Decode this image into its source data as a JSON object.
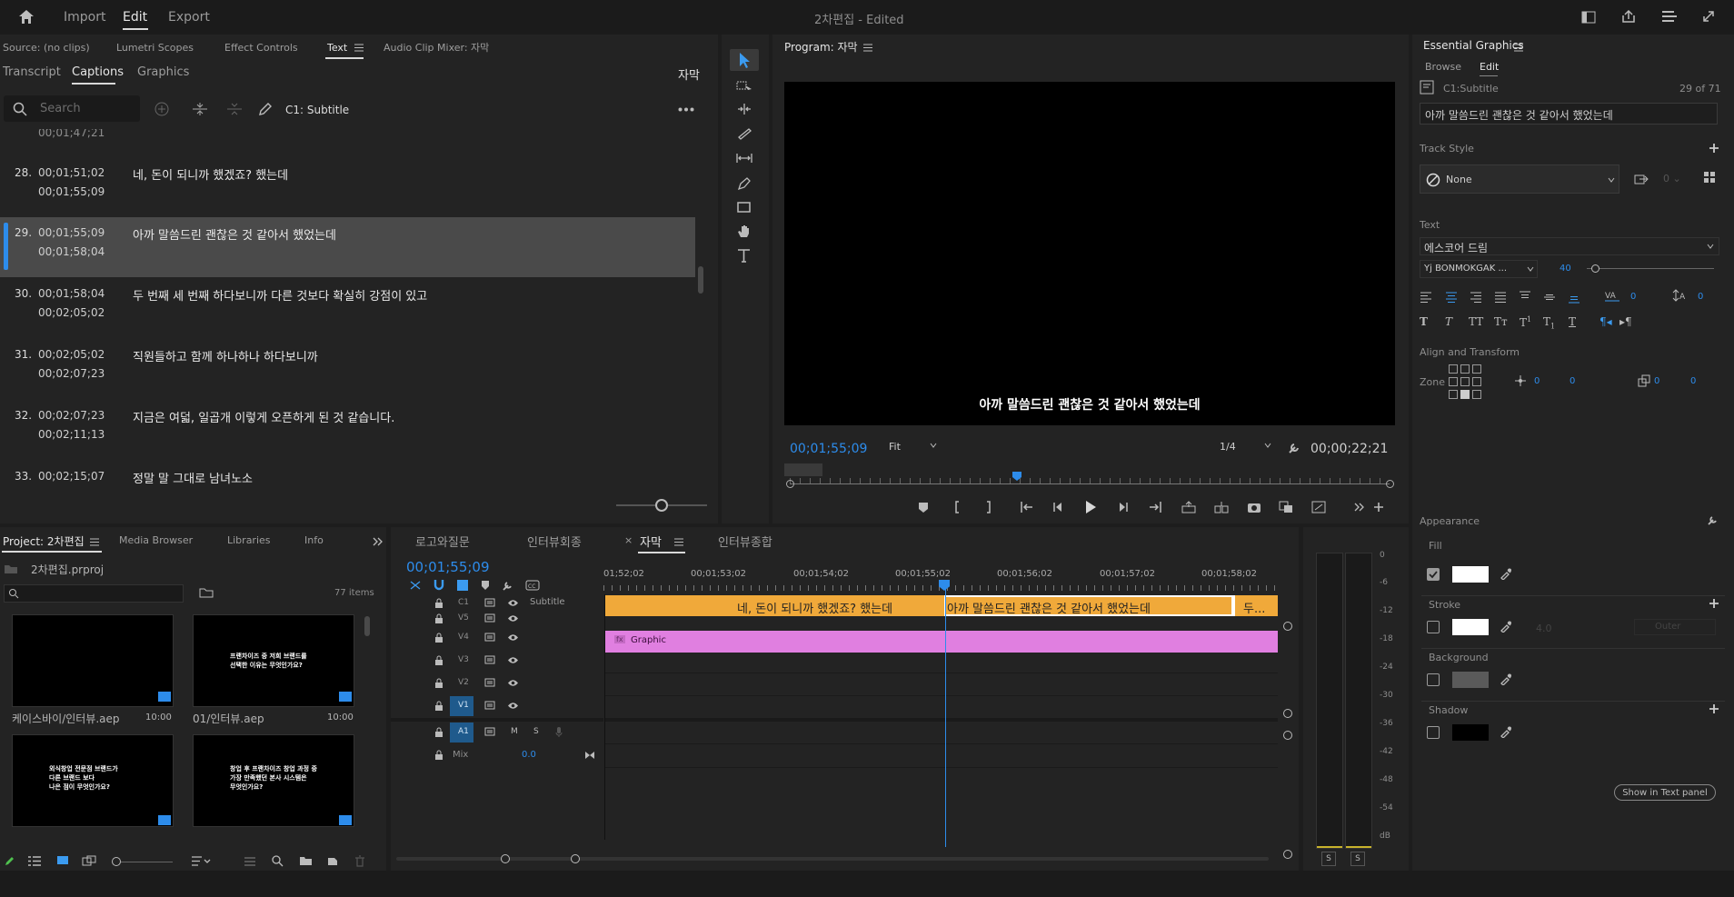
{
  "app": {
    "title": "2차편집",
    "title_suffix": "- Edited",
    "nav": [
      "Import",
      "Edit",
      "Export"
    ],
    "active_nav": "Edit"
  },
  "source_tabs": [
    "Source: (no clips)",
    "Lumetri Scopes",
    "Effect Controls",
    "Text",
    "Audio Clip Mixer: 자막"
  ],
  "text_panel": {
    "subtabs": [
      "Transcript",
      "Captions",
      "Graphics"
    ],
    "right_label": "자막",
    "search_placeholder": "Search",
    "track_label": "C1: Subtitle",
    "captions": [
      {
        "num": "",
        "start": "00;01;47;21",
        "end": "",
        "text": ""
      },
      {
        "num": "28.",
        "start": "00;01;51;02",
        "end": "00;01;55;09",
        "text": "네, 돈이 되니까 했겠죠? 했는데"
      },
      {
        "num": "29.",
        "start": "00;01;55;09",
        "end": "00;01;58;04",
        "text": "아까 말씀드린 괜찮은 것 같아서 했었는데"
      },
      {
        "num": "30.",
        "start": "00;01;58;04",
        "end": "00;02;05;02",
        "text": "두 번째  세 번째 하다보니까 다른 것보다 확실히 강점이 있고"
      },
      {
        "num": "31.",
        "start": "00;02;05;02",
        "end": "00;02;07;23",
        "text": "직원들하고 함께 하나하나 하다보니까"
      },
      {
        "num": "32.",
        "start": "00;02;07;23",
        "end": "00;02;11;13",
        "text": "지금은 여덟, 일곱개 이렇게 오픈하게 된 것 같습니다."
      },
      {
        "num": "33.",
        "start": "00;02;15;07",
        "end": "",
        "text": "정말 말 그대로 남녀노소"
      }
    ]
  },
  "program": {
    "title": "Program: 자막",
    "subtitle": "아까 말씀드린 괜찮은 것 같아서 했었는데",
    "timecode": "00;01;55;09",
    "fit": "Fit",
    "quality": "1/4",
    "duration": "00;00;22;21"
  },
  "project": {
    "tabs": [
      "Project: 2차편집",
      "Media Browser",
      "Libraries",
      "Info"
    ],
    "file": "2차편집.prproj",
    "items": "77 items",
    "thumbs": [
      {
        "name": "케이스바이/인터뷰.aep",
        "dur": "10:00",
        "lines": []
      },
      {
        "name": "01/인터뷰.aep",
        "dur": "10:00",
        "lines": [
          "프랜차이즈 중 저희 브랜드를",
          "선택한 이유는 무엇인가요?"
        ]
      },
      {
        "name": "",
        "dur": "",
        "lines": [
          "외식창업 전문점 브랜드가",
          "다른 브랜드 보다",
          "나은 점이 무엇인가요?"
        ]
      },
      {
        "name": "",
        "dur": "",
        "lines": [
          "창업 후 프랜차이즈 창업 과정 중",
          "가장 만족했던 본사 시스템은",
          "무엇인가요?"
        ]
      }
    ]
  },
  "timeline": {
    "tabs": [
      "로고와질문",
      "인터뷰회종",
      "자막",
      "인터뷰종합"
    ],
    "active": "자막",
    "timecode": "00;01;55;09",
    "ruler": [
      "01;52;02",
      "00;01;53;02",
      "00;01;54;02",
      "00;01;55;02",
      "00;01;56;02",
      "00;01;57;02",
      "00;01;58;02"
    ],
    "tracks": [
      "C1",
      "V5",
      "V4",
      "V3",
      "V2",
      "V1",
      "A1",
      "Mix"
    ],
    "subtitle_track": "Subtitle",
    "mix_value": "0.0",
    "graphic": "Graphic",
    "clips": [
      "네, 돈이 되니까 했겠죠? 했는데",
      "아까 말씀드린 괜찮은 것 같아서 했었는데",
      "두..."
    ]
  },
  "meter": {
    "scale": [
      "0",
      "-6",
      "-12",
      "-18",
      "-24",
      "-30",
      "-36",
      "-42",
      "-48",
      "-54",
      "dB"
    ],
    "solo": [
      "S",
      "S"
    ]
  },
  "eg": {
    "title": "Essential Graphics",
    "tabs": [
      "Browse",
      "Edit"
    ],
    "active_tab": "Edit",
    "track": "C1:Subtitle",
    "count": "29 of 71",
    "text_value": "아까 말씀드린 괜찮은 것 같아서 했었는데",
    "track_style_label": "Track Style",
    "track_style": "None",
    "text_label": "Text",
    "font": "에스코어 드림",
    "font_style": "Yj BONMOKGAK ...",
    "font_size": "40",
    "tracking": "0",
    "leading": "0",
    "align_label": "Align and Transform",
    "zone_label": "Zone",
    "pos_x": "0",
    "pos_y": "0",
    "scale_x": "0",
    "scale_y": "0",
    "appearance": "Appearance",
    "fill": "Fill",
    "stroke": "Stroke",
    "stroke_width": "4.0",
    "stroke_type": "Outer",
    "background": "Background",
    "shadow": "Shadow",
    "show_btn": "Show in Text panel",
    "colors": {
      "fill": "#ffffff",
      "stroke": "#ffffff",
      "background": "#5a5a5a",
      "shadow": "#000000"
    }
  },
  "colors": {
    "accent": "#2d8ceb",
    "caption_clip": "#f0a93a",
    "graphic_clip": "#e07fe0",
    "playhead": "#2d8ceb"
  }
}
